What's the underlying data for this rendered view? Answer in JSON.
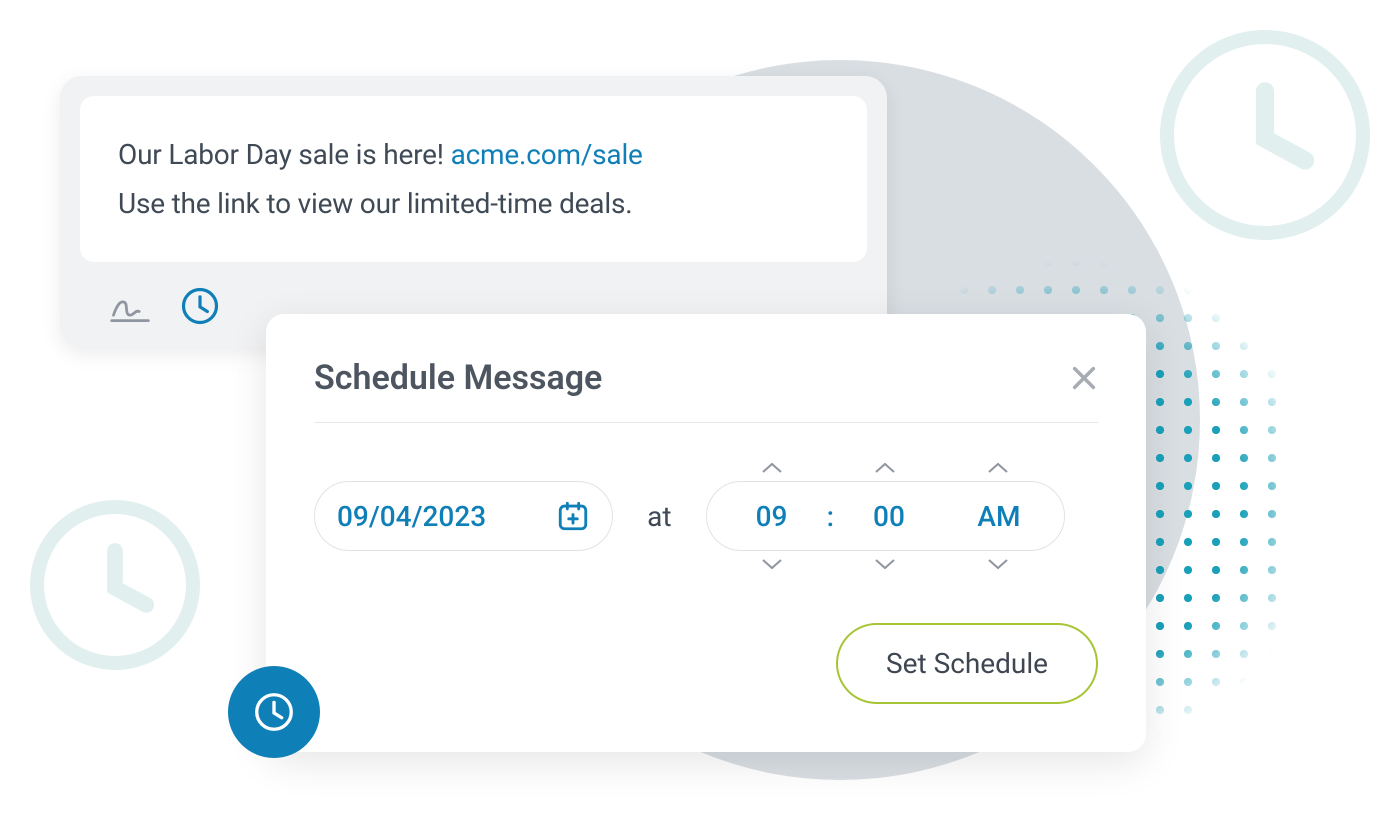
{
  "composer": {
    "message_line1_prefix": "Our Labor Day sale is here! ",
    "message_link_text": "acme.com/sale",
    "message_line2": "Use the link to view our limited-time deals."
  },
  "toolbar": {
    "signature_icon": "signature-icon",
    "clock_icon": "clock-icon"
  },
  "schedule": {
    "title": "Schedule Message",
    "date": "09/04/2023",
    "at_label": "at",
    "hour": "09",
    "colon": ":",
    "minute": "00",
    "ampm": "AM",
    "set_button": "Set Schedule"
  },
  "colors": {
    "accent_blue": "#0f7fb8",
    "accent_green": "#a6c534",
    "text_gray": "#3f4a56",
    "bg_gray": "#d9dee3",
    "dots_teal": "#1aa0b8"
  }
}
